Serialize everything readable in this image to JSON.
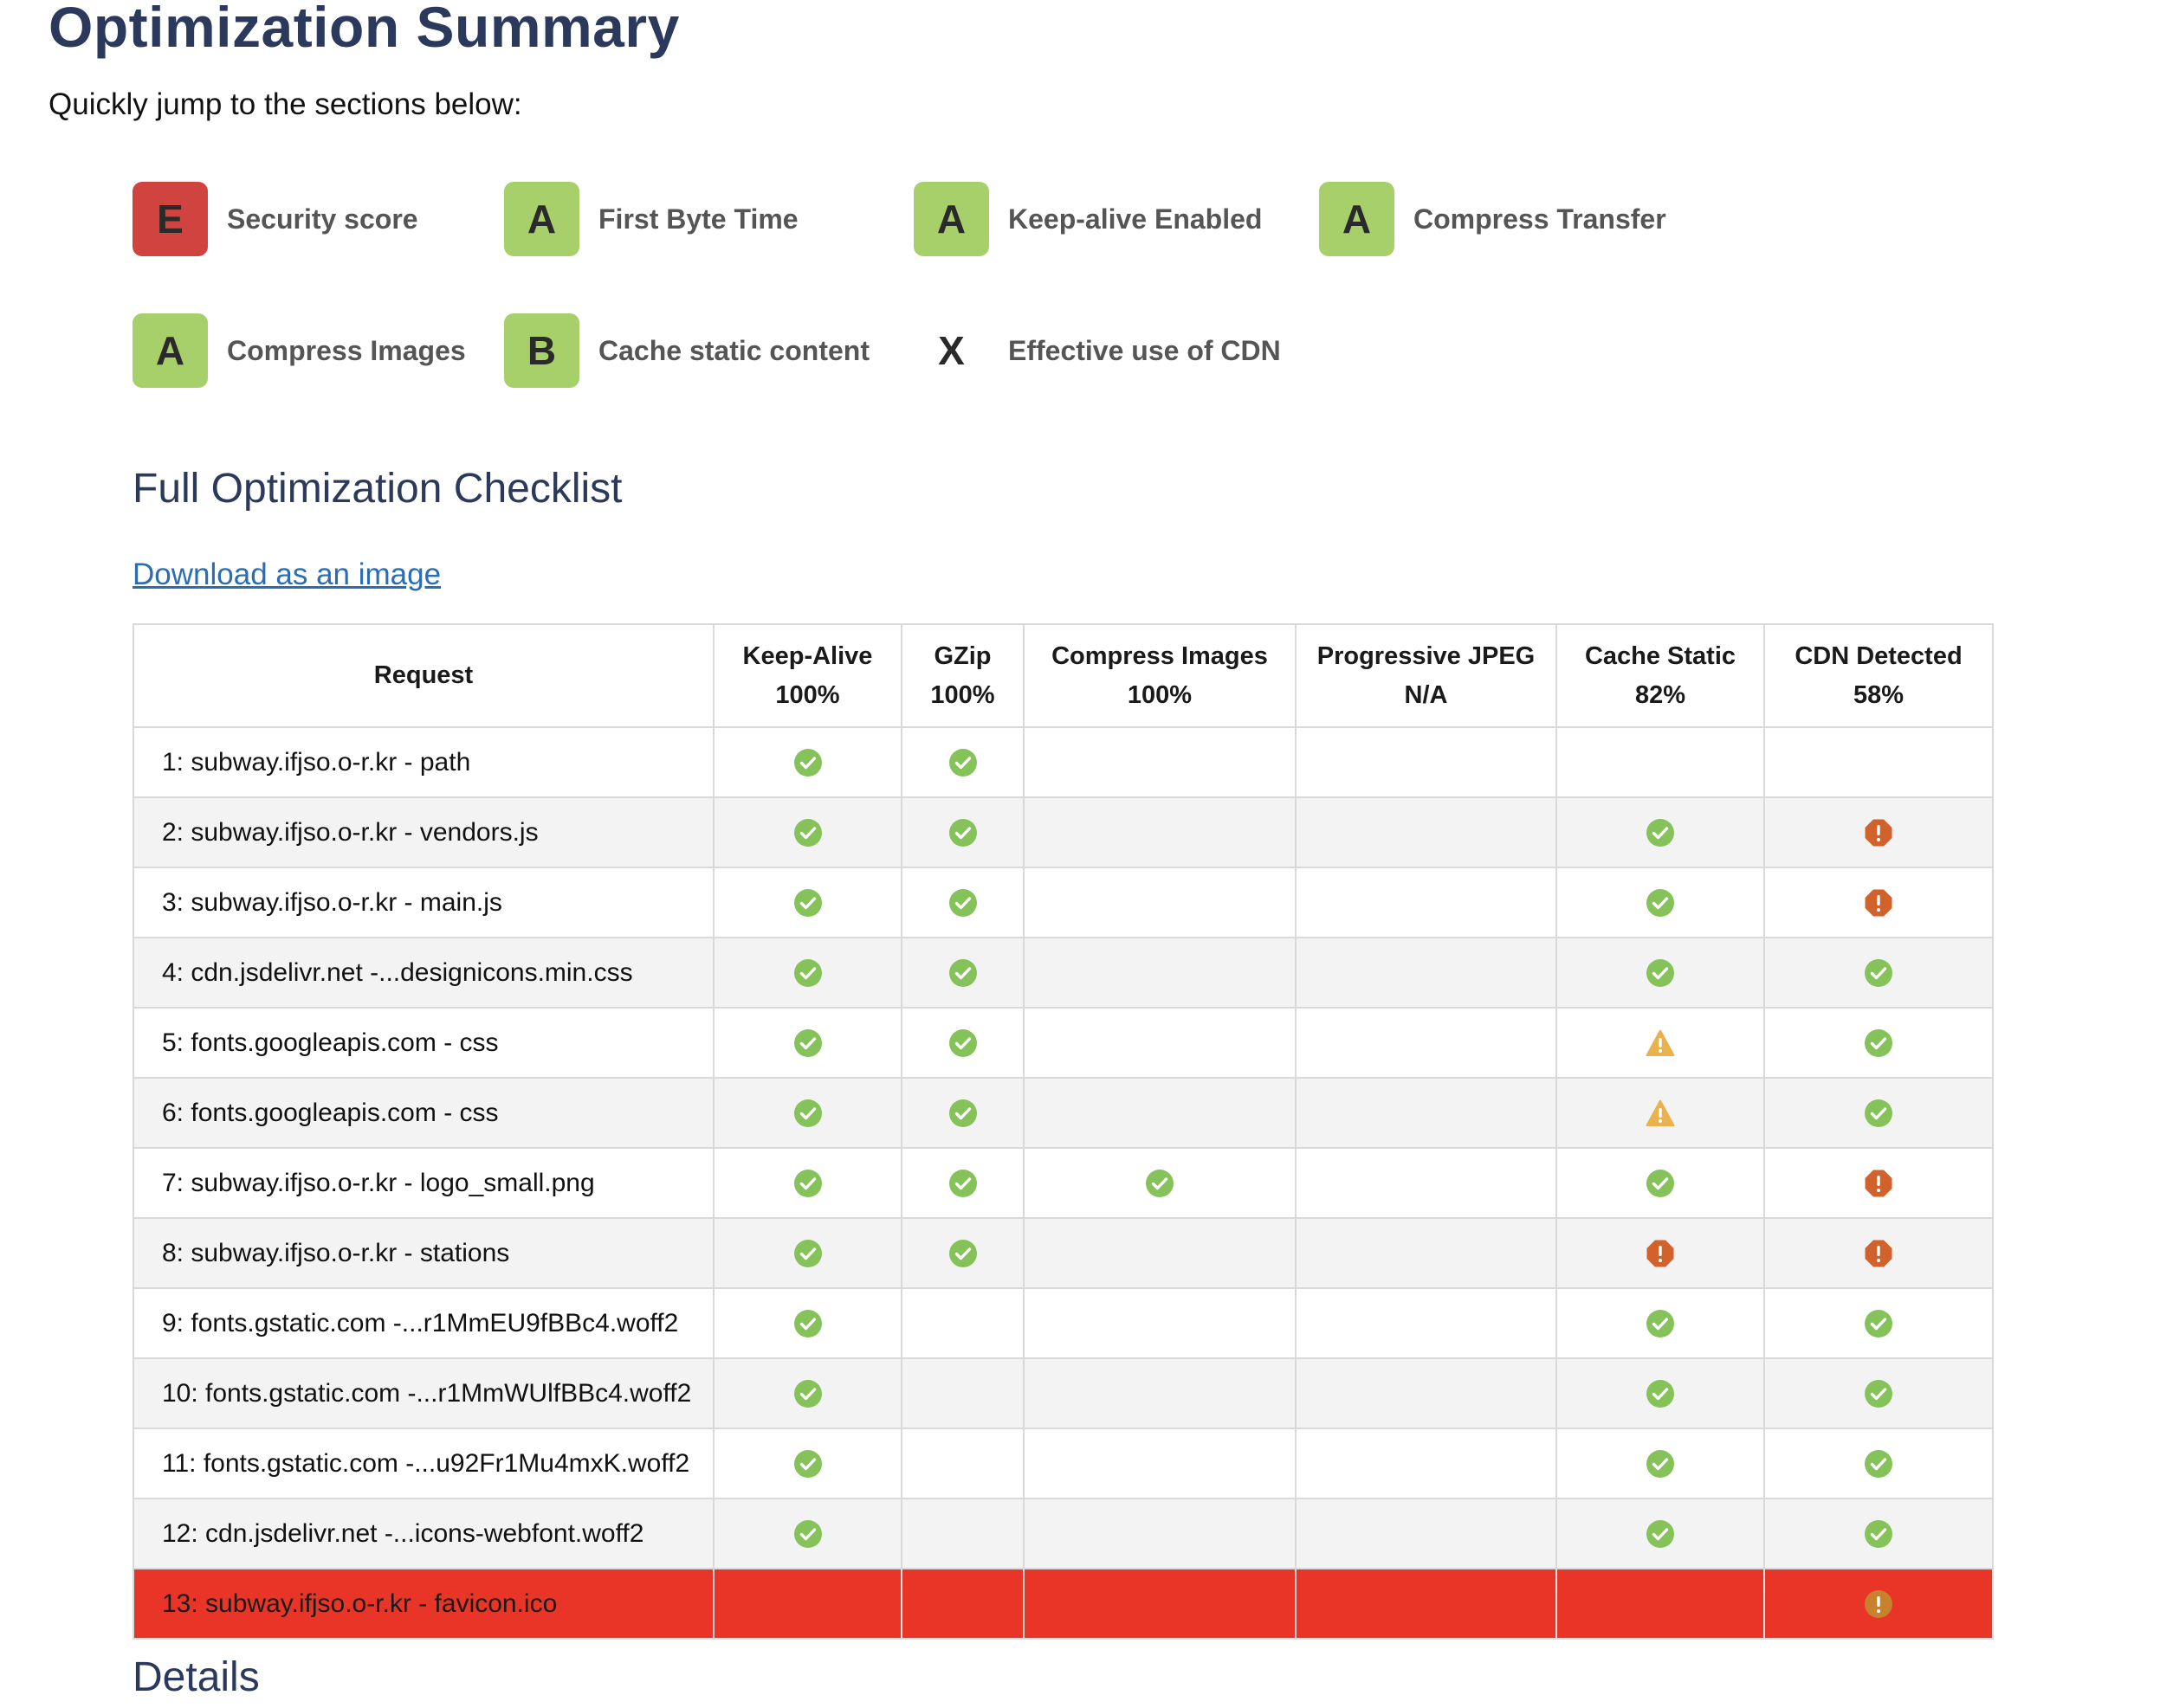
{
  "page": {
    "title": "Optimization Summary",
    "subtitle": "Quickly jump to the sections below:"
  },
  "grades": [
    {
      "grade": "E",
      "label": "Security score"
    },
    {
      "grade": "A",
      "label": "First Byte Time"
    },
    {
      "grade": "A",
      "label": "Keep-alive Enabled"
    },
    {
      "grade": "A",
      "label": "Compress Transfer"
    },
    {
      "grade": "A",
      "label": "Compress Images"
    },
    {
      "grade": "B",
      "label": "Cache static content"
    },
    {
      "grade": "X",
      "label": "Effective use of CDN"
    }
  ],
  "checklist": {
    "title": "Full Optimization Checklist",
    "download_label": "Download as an image",
    "columns": [
      {
        "name": "Request",
        "score": ""
      },
      {
        "name": "Keep-Alive",
        "score": "100%"
      },
      {
        "name": "GZip",
        "score": "100%"
      },
      {
        "name": "Compress Images",
        "score": "100%"
      },
      {
        "name": "Progressive JPEG",
        "score": "N/A"
      },
      {
        "name": "Cache Static",
        "score": "82%"
      },
      {
        "name": "CDN Detected",
        "score": "58%"
      }
    ],
    "rows": [
      {
        "request": "1: subway.ifjso.o-r.kr - path",
        "keep_alive": "pass",
        "gzip": "pass",
        "compress_images": "",
        "progressive_jpeg": "",
        "cache_static": "",
        "cdn": ""
      },
      {
        "request": "2: subway.ifjso.o-r.kr - vendors.js",
        "keep_alive": "pass",
        "gzip": "pass",
        "compress_images": "",
        "progressive_jpeg": "",
        "cache_static": "pass",
        "cdn": "fail"
      },
      {
        "request": "3: subway.ifjso.o-r.kr - main.js",
        "keep_alive": "pass",
        "gzip": "pass",
        "compress_images": "",
        "progressive_jpeg": "",
        "cache_static": "pass",
        "cdn": "fail"
      },
      {
        "request": "4: cdn.jsdelivr.net -...designicons.min.css",
        "keep_alive": "pass",
        "gzip": "pass",
        "compress_images": "",
        "progressive_jpeg": "",
        "cache_static": "pass",
        "cdn": "pass"
      },
      {
        "request": "5: fonts.googleapis.com - css",
        "keep_alive": "pass",
        "gzip": "pass",
        "compress_images": "",
        "progressive_jpeg": "",
        "cache_static": "warn",
        "cdn": "pass"
      },
      {
        "request": "6: fonts.googleapis.com - css",
        "keep_alive": "pass",
        "gzip": "pass",
        "compress_images": "",
        "progressive_jpeg": "",
        "cache_static": "warn",
        "cdn": "pass"
      },
      {
        "request": "7: subway.ifjso.o-r.kr - logo_small.png",
        "keep_alive": "pass",
        "gzip": "pass",
        "compress_images": "pass",
        "progressive_jpeg": "",
        "cache_static": "pass",
        "cdn": "fail"
      },
      {
        "request": "8: subway.ifjso.o-r.kr - stations",
        "keep_alive": "pass",
        "gzip": "pass",
        "compress_images": "",
        "progressive_jpeg": "",
        "cache_static": "fail",
        "cdn": "fail"
      },
      {
        "request": "9: fonts.gstatic.com -...r1MmEU9fBBc4.woff2",
        "keep_alive": "pass",
        "gzip": "",
        "compress_images": "",
        "progressive_jpeg": "",
        "cache_static": "pass",
        "cdn": "pass"
      },
      {
        "request": "10: fonts.gstatic.com -...r1MmWUlfBBc4.woff2",
        "keep_alive": "pass",
        "gzip": "",
        "compress_images": "",
        "progressive_jpeg": "",
        "cache_static": "pass",
        "cdn": "pass"
      },
      {
        "request": "11: fonts.gstatic.com -...u92Fr1Mu4mxK.woff2",
        "keep_alive": "pass",
        "gzip": "",
        "compress_images": "",
        "progressive_jpeg": "",
        "cache_static": "pass",
        "cdn": "pass"
      },
      {
        "request": "12: cdn.jsdelivr.net -...icons-webfont.woff2",
        "keep_alive": "pass",
        "gzip": "",
        "compress_images": "",
        "progressive_jpeg": "",
        "cache_static": "pass",
        "cdn": "pass"
      },
      {
        "request": "13: subway.ifjso.o-r.kr - favicon.ico",
        "keep_alive": "",
        "gzip": "",
        "compress_images": "",
        "progressive_jpeg": "",
        "cache_static": "",
        "cdn": "error",
        "row_status": "error"
      }
    ]
  },
  "details": {
    "title": "Details"
  },
  "icons": {
    "pass": "check-circle-icon",
    "fail": "alert-octagon-icon",
    "warn": "warning-triangle-icon",
    "error": "alert-circle-icon"
  },
  "colors": {
    "title": "#2b3a5c",
    "grade_good": "#a8d06a",
    "grade_bad": "#d0433f",
    "pass": "#86c25a",
    "fail": "#d2622b",
    "warn": "#eab24c",
    "error_row": "#e83527",
    "error_icon": "#c8822e",
    "link": "#2a6db5"
  }
}
